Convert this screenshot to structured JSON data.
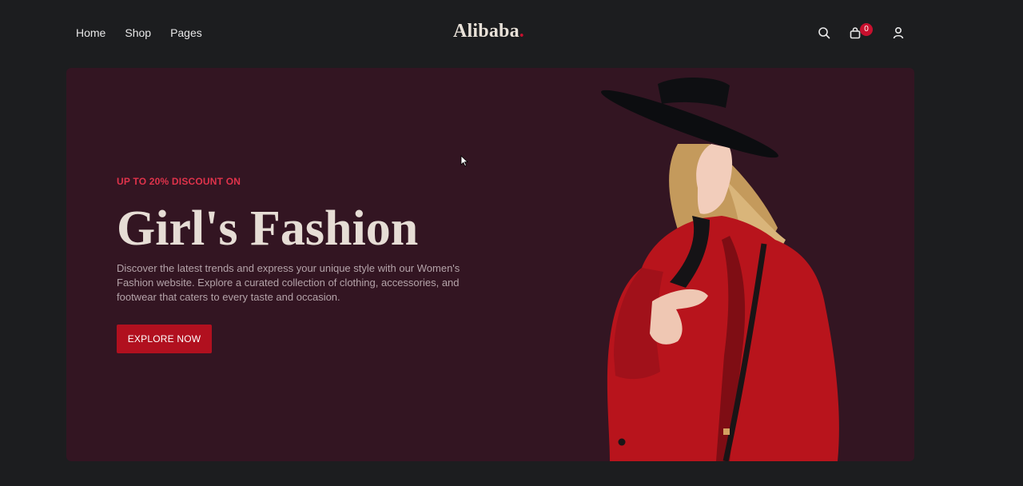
{
  "nav": {
    "links": [
      "Home",
      "Shop",
      "Pages"
    ],
    "icons": [
      "search-icon",
      "bag-icon",
      "user-icon"
    ],
    "cart_count": "0"
  },
  "brand": {
    "name": "Alibaba",
    "dot": "."
  },
  "hero": {
    "eyebrow": "UP TO 20% DISCOUNT ON",
    "title": "Girl's Fashion",
    "description": "Discover the latest trends and express your unique style with our Women's Fashion website. Explore a curated collection of clothing, accessories, and footwear that caters to every taste and occasion.",
    "cta_label": "EXPLORE NOW"
  },
  "colors": {
    "page_bg": "#1c1d1f",
    "hero_bg": "#331522",
    "accent": "#c8102e",
    "headline": "#e6ddd5"
  }
}
